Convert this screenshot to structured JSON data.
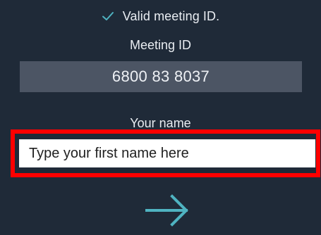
{
  "status": {
    "valid_text": "Valid meeting ID.",
    "icon": "check-icon",
    "color": "#4fb3c1"
  },
  "meeting": {
    "label": "Meeting ID",
    "value": "6800 83 8037"
  },
  "name": {
    "label": "Your name",
    "placeholder": "Type your first name here",
    "value": ""
  },
  "next": {
    "icon": "arrow-right-icon",
    "color": "#4fb3c1"
  },
  "highlight_color": "#ff0000"
}
